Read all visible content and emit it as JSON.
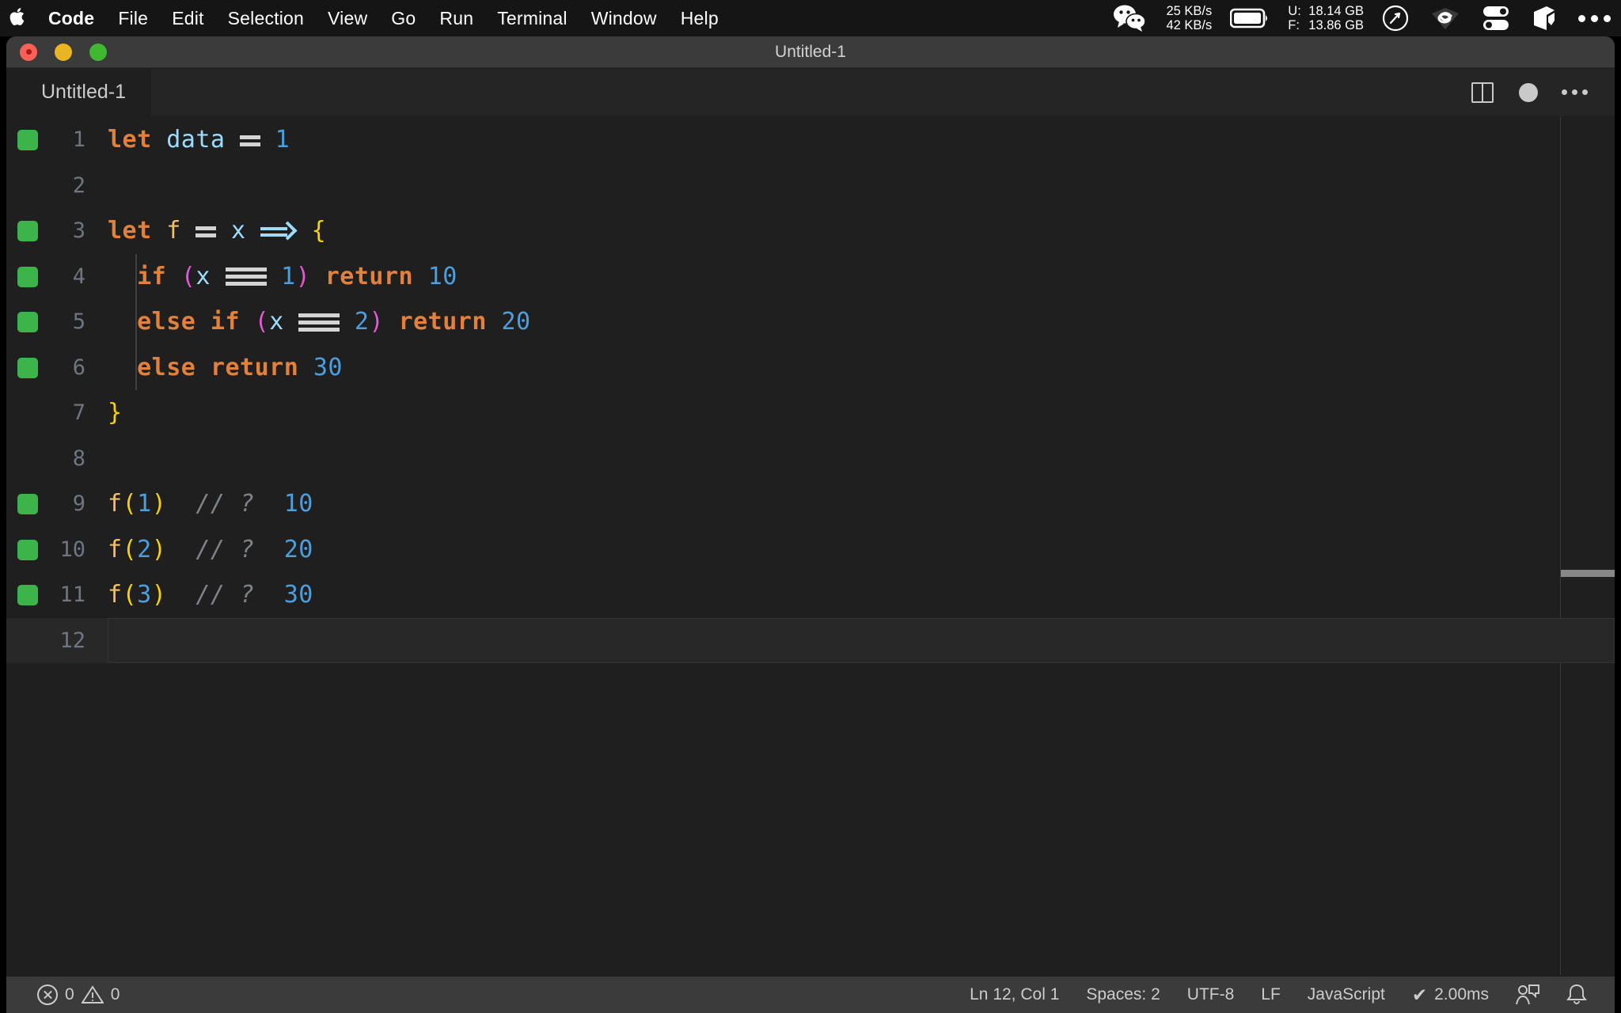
{
  "menubar": {
    "apple_icon": "apple-logo-icon",
    "items": [
      {
        "label": "Code",
        "bold": true
      },
      {
        "label": "File",
        "bold": false
      },
      {
        "label": "Edit",
        "bold": false
      },
      {
        "label": "Selection",
        "bold": false
      },
      {
        "label": "View",
        "bold": false
      },
      {
        "label": "Go",
        "bold": false
      },
      {
        "label": "Run",
        "bold": false
      },
      {
        "label": "Terminal",
        "bold": false
      },
      {
        "label": "Window",
        "bold": false
      },
      {
        "label": "Help",
        "bold": false
      }
    ],
    "status": {
      "wechat_icon": "wechat-icon",
      "network_up": "25 KB/s",
      "network_down": "42 KB/s",
      "battery_icon": "battery-icon",
      "memory_used_label": "U:",
      "memory_used_value": "18.14 GB",
      "memory_free_label": "F:",
      "memory_free_value": "13.86 GB",
      "compass_icon": "compass-icon",
      "eye_icon": "eye-icon",
      "toggles_icon": "control-center-icon",
      "cube_icon": "cube-icon",
      "more_icon": "ellipsis-icon"
    }
  },
  "window": {
    "title": "Untitled-1",
    "traffic_lights": [
      "close-button",
      "minimize-button",
      "maximize-button"
    ]
  },
  "tab": {
    "label": "Untitled-1",
    "actions": {
      "split_editor": "split-editor-icon",
      "unsaved_dot": "unsaved-indicator",
      "more": "more-actions-icon"
    }
  },
  "editor": {
    "language": "JavaScript",
    "lines": [
      {
        "no": "1",
        "git": true,
        "current": false
      },
      {
        "no": "2",
        "git": false,
        "current": false
      },
      {
        "no": "3",
        "git": true,
        "current": false
      },
      {
        "no": "4",
        "git": true,
        "current": false
      },
      {
        "no": "5",
        "git": true,
        "current": false
      },
      {
        "no": "6",
        "git": true,
        "current": false
      },
      {
        "no": "7",
        "git": false,
        "current": false
      },
      {
        "no": "8",
        "git": false,
        "current": false
      },
      {
        "no": "9",
        "git": true,
        "current": false
      },
      {
        "no": "10",
        "git": true,
        "current": false
      },
      {
        "no": "11",
        "git": true,
        "current": false
      },
      {
        "no": "12",
        "git": false,
        "current": true
      }
    ],
    "code": {
      "l1_kw": "let",
      "l1_var": "data",
      "l1_num": "1",
      "l3_kw": "let",
      "l3_fn": "f",
      "l3_var": "x",
      "l3_brace": "{",
      "l4_if": "if",
      "l4_open": "(",
      "l4_var": "x",
      "l4_num": "1",
      "l4_close": ")",
      "l4_return": "return",
      "l4_val": "10",
      "l5_else": "else",
      "l5_if": "if",
      "l5_open": "(",
      "l5_var": "x",
      "l5_num": "2",
      "l5_close": ")",
      "l5_return": "return",
      "l5_val": "20",
      "l6_else": "else",
      "l6_return": "return",
      "l6_val": "30",
      "l7_brace": "}",
      "l9_fn": "f",
      "l9_open": "(",
      "l9_arg": "1",
      "l9_close": ")",
      "l9_cmt": "// ?",
      "l9_res": "10",
      "l10_fn": "f",
      "l10_open": "(",
      "l10_arg": "2",
      "l10_close": ")",
      "l10_cmt": "// ?",
      "l10_res": "20",
      "l11_fn": "f",
      "l11_open": "(",
      "l11_arg": "3",
      "l11_close": ")",
      "l11_cmt": "// ?",
      "l11_res": "30"
    }
  },
  "statusbar": {
    "errors_icon": "error-icon",
    "errors": "0",
    "warnings_icon": "warning-icon",
    "warnings": "0",
    "cursor": "Ln 12, Col 1",
    "indentation": "Spaces: 2",
    "encoding": "UTF-8",
    "eol": "LF",
    "language": "JavaScript",
    "runtime": "2.00ms",
    "runtime_check": "✔",
    "feedback_icon": "feedback-icon",
    "bell_icon": "notifications-bell-icon"
  },
  "colors": {
    "editor_bg": "#1f1f1f",
    "titlebar_bg": "#3b3b3b",
    "git_added": "#3cb44a",
    "keyword": "#e2803c",
    "number": "#4a9fe0",
    "function": "#f5c063",
    "brace": "#f5d302",
    "paren_magenta": "#e855d8",
    "comment": "#7f8389",
    "variable": "#9cdcfe"
  }
}
